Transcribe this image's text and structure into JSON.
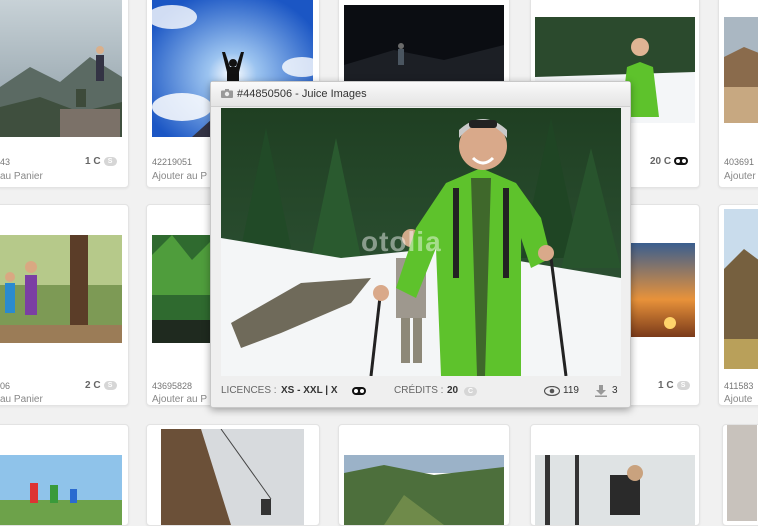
{
  "grid": {
    "row1": [
      {
        "id_fragment": "43",
        "price": "1 C",
        "coin": "S",
        "basket": "au Panier"
      },
      {
        "id": "42219051",
        "basket": "Ajouter au P"
      },
      {
        "price": "20 C"
      },
      {
        "id_fragment": "403691",
        "basket": "Ajouter"
      }
    ],
    "row2": [
      {
        "id_fragment": "06",
        "price": "2 C",
        "coin": "S",
        "basket": "au Panier"
      },
      {
        "id": "43695828",
        "basket": "Ajouter au P"
      },
      {
        "price": "1 C",
        "coin": "S"
      },
      {
        "id_fragment": "411583",
        "basket": "Ajoute"
      }
    ]
  },
  "popover": {
    "title": "#44850506 - Juice Images",
    "watermark": "otolia",
    "licences_label": "LICENCES :",
    "licences_value": "XS - XXL | X",
    "credits_label": "CRÉDITS :",
    "credits_value": "20",
    "credits_coin": "C",
    "views": "119",
    "downloads": "3"
  },
  "colors": {
    "page_bg": "#f1f1f1",
    "jacket_green": "#5ec22c",
    "sky_blue": "#2f6fd0"
  }
}
